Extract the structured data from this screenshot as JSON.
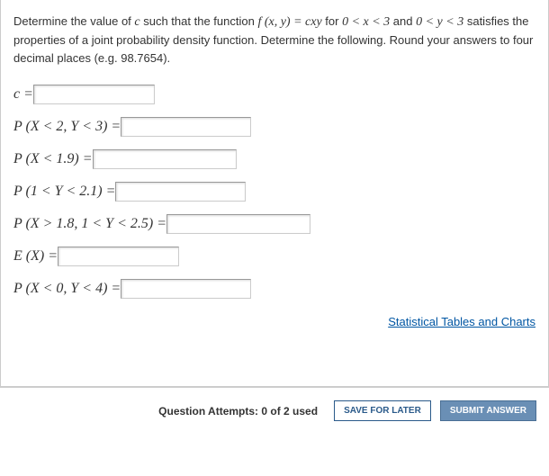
{
  "problem": {
    "part1": "Determine the value of ",
    "c": "c",
    "part2": " such that the function ",
    "fn": "f (x, y) = cxy",
    "part3": " for ",
    "cond1": "0 < x < 3",
    "and": " and ",
    "cond2": "0 < y < 3",
    "part4": " satisfies the properties of a joint probability density function. Determine the following. Round your answers to four decimal places (e.g. 98.7654)."
  },
  "rows": {
    "r1": "c =",
    "r2": "P (X < 2, Y < 3) =",
    "r3": "P (X < 1.9) =",
    "r4": "P (1 < Y < 2.1) =",
    "r5": "P (X > 1.8, 1 < Y < 2.5) =",
    "r6": "E (X) =",
    "r7": "P (X < 0, Y < 4) ="
  },
  "link": "Statistical Tables and Charts",
  "footer": {
    "attempts": "Question Attempts: 0 of 2 used",
    "save": "SAVE FOR LATER",
    "submit": "SUBMIT ANSWER"
  }
}
